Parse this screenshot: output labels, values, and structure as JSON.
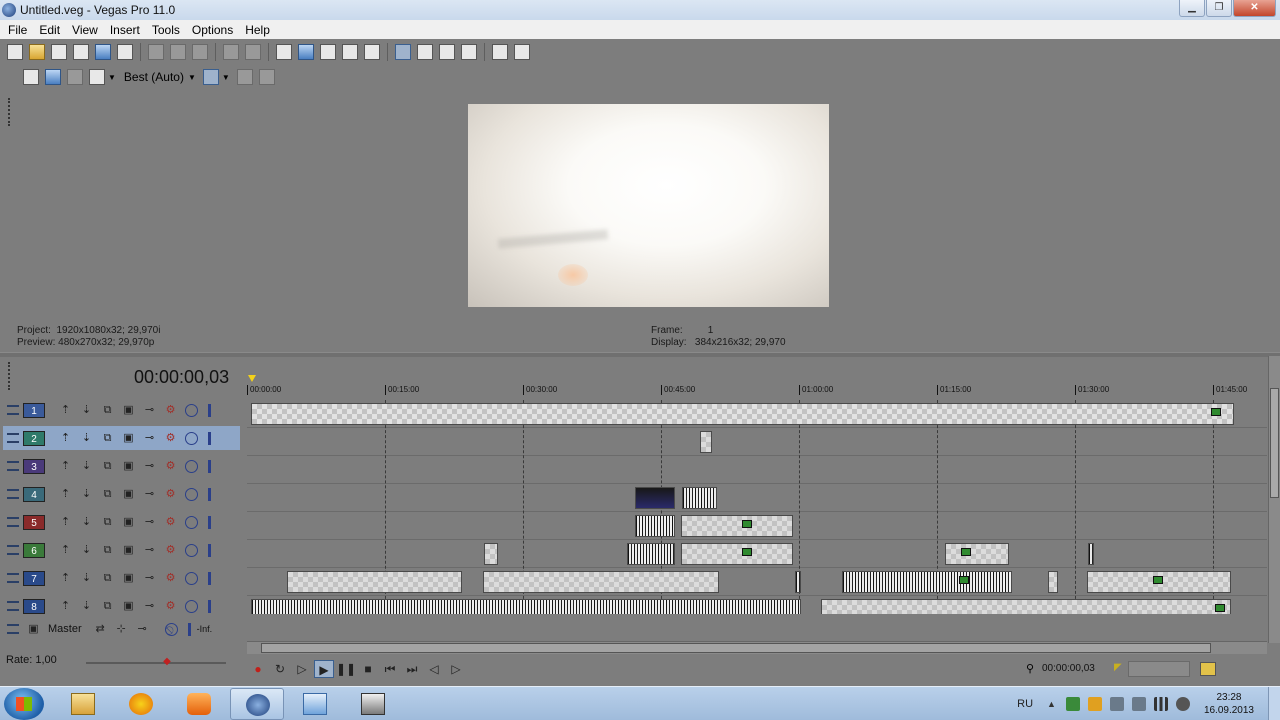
{
  "window": {
    "title": "Untitled.veg - Vegas Pro 11.0"
  },
  "menu": [
    "File",
    "Edit",
    "View",
    "Insert",
    "Tools",
    "Options",
    "Help"
  ],
  "preview": {
    "quality": "Best (Auto)",
    "project_label": "Project:",
    "project_value": "1920x1080x32; 29,970i",
    "preview_label": "Preview:",
    "preview_value": "480x270x32; 29,970p",
    "frame_label": "Frame:",
    "frame_value": "1",
    "display_label": "Display:",
    "display_value": "384x216x32; 29,970"
  },
  "timeline": {
    "timecode": "00:00:00,03",
    "ruler": [
      "00:00:00",
      "00:15:00",
      "00:30:00",
      "00:45:00",
      "01:00:00",
      "01:15:00",
      "01:30:00",
      "01:45:00"
    ],
    "tracks": [
      {
        "number": "1",
        "color": "#3a5a9a"
      },
      {
        "number": "2",
        "color": "#2f7a6a"
      },
      {
        "number": "3",
        "color": "#4a3a7a"
      },
      {
        "number": "4",
        "color": "#3a6a7a"
      },
      {
        "number": "5",
        "color": "#8a2a2a"
      },
      {
        "number": "6",
        "color": "#3a7a3a"
      },
      {
        "number": "7",
        "color": "#2a4a8a"
      },
      {
        "number": "8",
        "color": "#2a4a8a"
      }
    ],
    "master_label": "Master",
    "master_level": "-Inf.",
    "rate": "Rate: 1,00",
    "cursor_time": "00:00:00,03"
  },
  "taskbar": {
    "lang": "RU",
    "time": "23:28",
    "date": "16.09.2013"
  }
}
